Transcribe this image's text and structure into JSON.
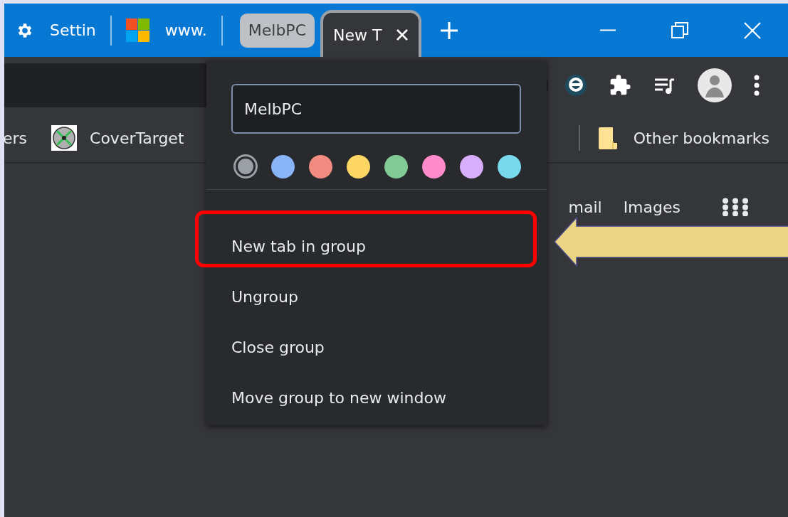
{
  "tabs": [
    {
      "kind": "settings",
      "title": "Settin",
      "selected": false
    },
    {
      "kind": "site",
      "title": "www.",
      "selected": false
    },
    {
      "kind": "group",
      "title": "MelbPC",
      "selected": false
    },
    {
      "kind": "page",
      "title": "New T",
      "selected": true
    }
  ],
  "bookmarks": [
    {
      "kind": "plain",
      "title": "ers"
    },
    {
      "kind": "disc",
      "title": "CoverTarget"
    },
    {
      "kind": "folder",
      "title": "Other bookmarks"
    }
  ],
  "page_links": [
    "mail",
    "Images"
  ],
  "group_menu": {
    "name_field": {
      "value": "MelbPC"
    },
    "colors": [
      {
        "color": "#9aa0a6",
        "selected": true
      },
      {
        "color": "#8ab4f8",
        "selected": false
      },
      {
        "color": "#f28b82",
        "selected": false
      },
      {
        "color": "#fdd663",
        "selected": false
      },
      {
        "color": "#81c995",
        "selected": false
      },
      {
        "color": "#ff8bcb",
        "selected": false
      },
      {
        "color": "#d7aefb",
        "selected": false
      },
      {
        "color": "#78d9ec",
        "selected": false
      }
    ],
    "items": [
      {
        "label": "New tab in group",
        "highlighted": true
      },
      {
        "label": "Ungroup",
        "highlighted": false
      },
      {
        "label": "Close group",
        "highlighted": false
      },
      {
        "label": "Move group to new window",
        "highlighted": false
      }
    ]
  }
}
